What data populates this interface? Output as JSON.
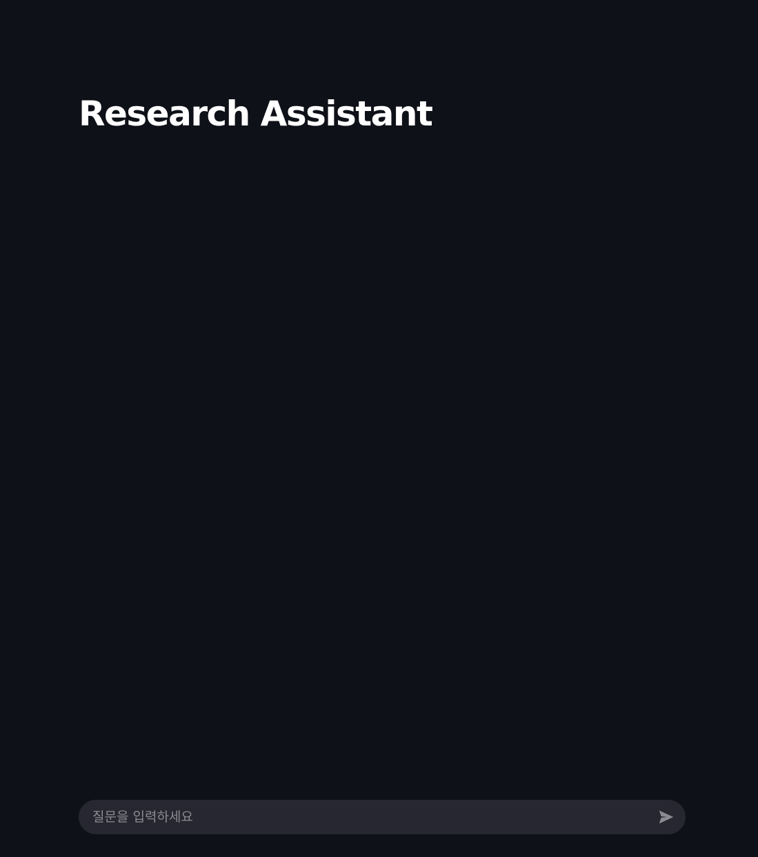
{
  "header": {
    "title": "Research Assistant"
  },
  "chat": {
    "input_placeholder": "질문을 입력하세요",
    "input_value": "",
    "send_icon": "send-icon"
  },
  "colors": {
    "background": "#0f1118",
    "input_background": "#262730",
    "placeholder": "#8b8c93",
    "send_icon": "#8b8c93",
    "title": "#ffffff"
  }
}
